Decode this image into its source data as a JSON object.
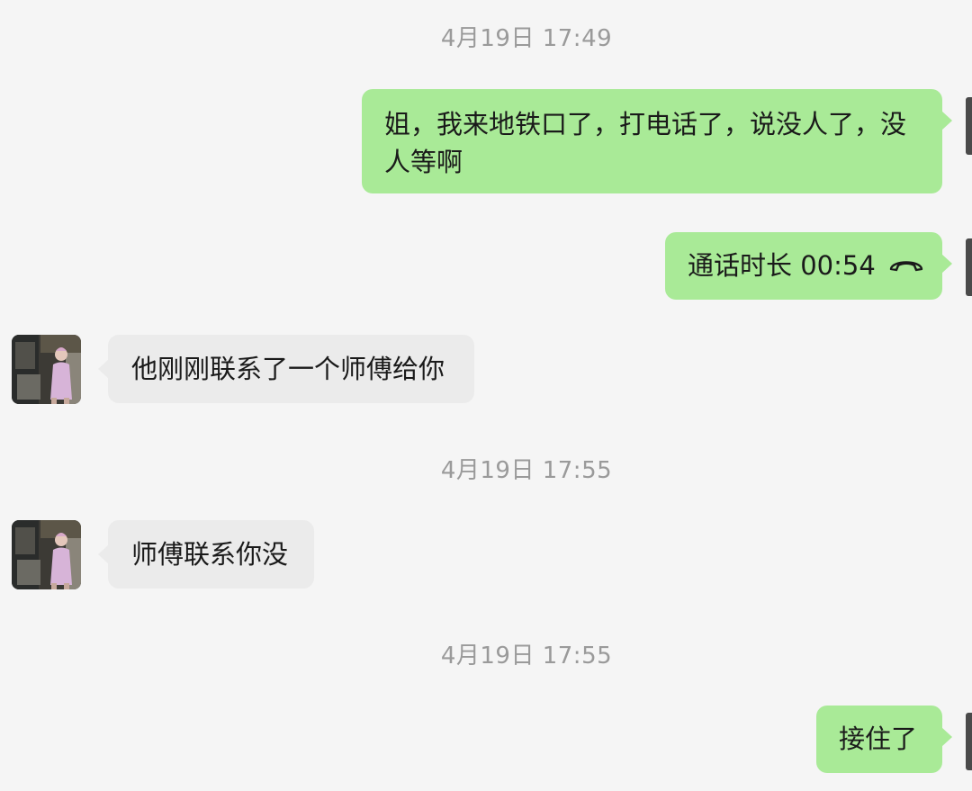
{
  "messages": {
    "ts1": "4月19日 17:49",
    "m1_line1": "姐，我来地铁口了，打电话了，说没人了，没",
    "m1_line2": "人等啊",
    "m2_text": "通话时长 00:54",
    "m3_text": "他刚刚联系了一个师傅给你",
    "ts2": "4月19日 17:55",
    "m4_text": "师傅联系你没",
    "ts3": "4月19日 17:55",
    "m5_text": "接住了"
  },
  "icons": {
    "call": "phone-hangup-icon",
    "contact_avatar": "contact-avatar-photo",
    "self_avatar": "self-avatar"
  },
  "colors": {
    "background": "#f5f5f5",
    "outgoing_bubble": "#a9ea97",
    "incoming_bubble": "#ebebeb",
    "timestamp": "#9a9a9a"
  }
}
